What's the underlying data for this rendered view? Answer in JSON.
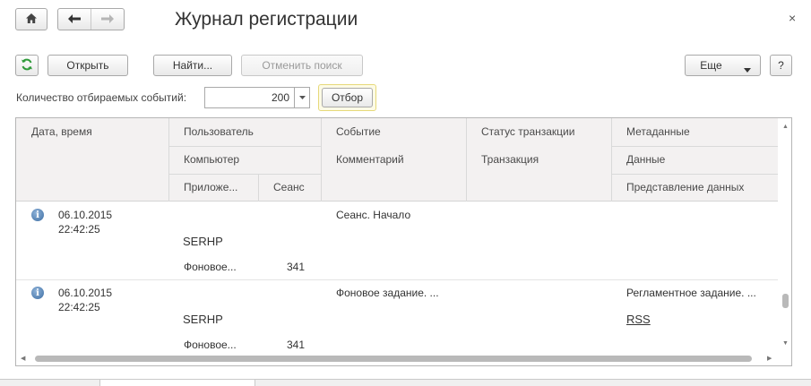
{
  "window": {
    "title": "Журнал регистрации",
    "close_glyph": "×"
  },
  "nav": {
    "home_icon": "home-icon",
    "back_icon": "arrow-left-icon",
    "forward_icon": "arrow-right-icon"
  },
  "toolbar": {
    "refresh_icon": "refresh-icon",
    "open_label": "Открыть",
    "find_label": "Найти...",
    "cancel_search_label": "Отменить поиск",
    "more_label": "Еще",
    "help_label": "?"
  },
  "filter_row": {
    "count_label": "Количество отбираемых событий:",
    "count_value": "200",
    "filter_label": "Отбор"
  },
  "table": {
    "headers": {
      "datetime": "Дата, время",
      "user": "Пользователь",
      "computer": "Компьютер",
      "application": "Приложе...",
      "session": "Сеанс",
      "event": "Событие",
      "comment": "Комментарий",
      "tx_status": "Статус транзакции",
      "transaction": "Транзакция",
      "metadata": "Метаданные",
      "data": "Данные",
      "data_presentation": "Представление данных"
    },
    "rows": [
      {
        "date": "06.10.2015",
        "time": "22:42:25",
        "computer": "SERHP",
        "application": "Фоновое...",
        "session": "341",
        "event": "Сеанс. Начало",
        "metadata": "",
        "data": ""
      },
      {
        "date": "06.10.2015",
        "time": "22:42:25",
        "computer": "SERHP",
        "application": "Фоновое...",
        "session": "341",
        "event": "Фоновое задание. ...",
        "metadata": "Регламентное задание. ...",
        "data": "RSS"
      }
    ]
  }
}
